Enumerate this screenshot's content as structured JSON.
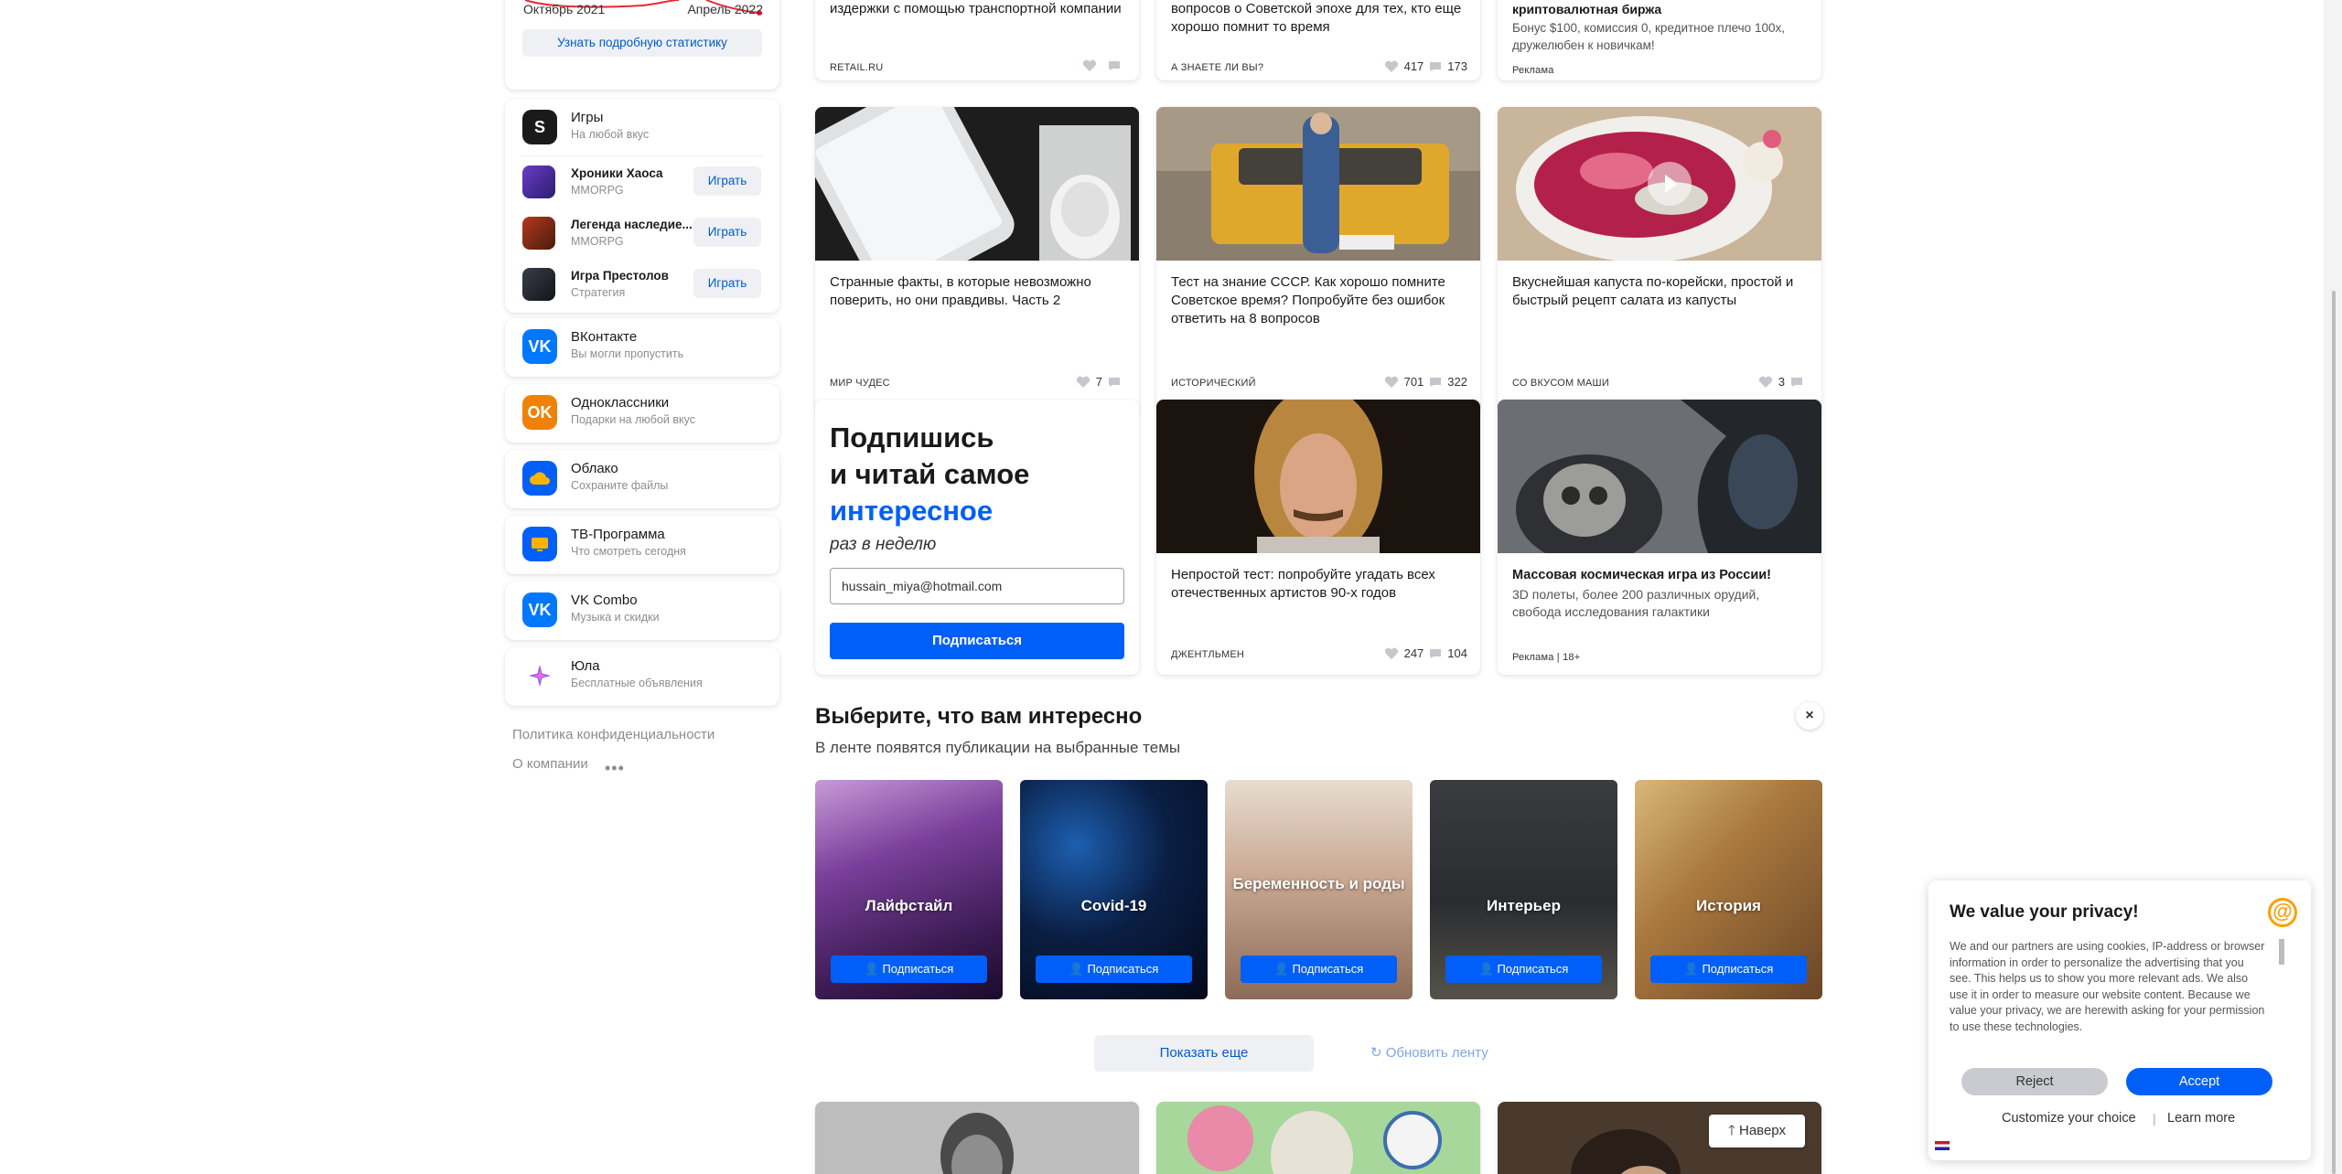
{
  "sidebar": {
    "stats": {
      "label_left": "Октябрь 2021",
      "label_right": "Апрель 2022",
      "button": "Узнать подробную статистику",
      "line_color": "#e52a3a"
    },
    "games": {
      "title": "Игры",
      "subtitle": "На любой вкус",
      "items": [
        {
          "title": "Хроники Хаоса",
          "genre": "MMORPG",
          "button": "Играть"
        },
        {
          "title": "Легенда наследие...",
          "genre": "MMORPG",
          "button": "Играть"
        },
        {
          "title": "Игра Престолов",
          "genre": "Стратегия",
          "button": "Играть"
        }
      ]
    },
    "services": [
      {
        "title": "ВКонтакте",
        "subtitle": "Вы могли пропустить",
        "icon": "vk-icon",
        "color": "#0077ff"
      },
      {
        "title": "Одноклассники",
        "subtitle": "Подарки на любой вкус",
        "icon": "ok-icon",
        "color": "#ee8208"
      },
      {
        "title": "Облако",
        "subtitle": "Сохраните файлы",
        "icon": "cloud-icon",
        "color": "#005ff9"
      },
      {
        "title": "ТВ-Программа",
        "subtitle": "Что смотреть сегодня",
        "icon": "tv-icon",
        "color": "#005ff9"
      },
      {
        "title": "VK Combo",
        "subtitle": "Музыка и скидки",
        "icon": "vk-icon",
        "color": "#0077ff"
      },
      {
        "title": "Юла",
        "subtitle": "Бесплатные объявления",
        "icon": "sparkle-icon",
        "color": "#ffffff"
      }
    ],
    "footer": {
      "privacy": "Политика конфиденциальности",
      "about": "О компании",
      "more": "•••"
    }
  },
  "feed": {
    "top_row": [
      {
        "title_tail": "издержки с помощью транспортной компании",
        "source": "RETAIL.RU",
        "likes": "",
        "comments": ""
      },
      {
        "title_tail": "вопросов о Советской эпохе для тех, кто еще хорошо помнит то время",
        "source": "А ЗНАЕТЕ ЛИ ВЫ?",
        "likes": "417",
        "comments": "173"
      },
      {
        "title_tail": "криптовалютная биржа",
        "desc": "Бонус $100, комиссия 0, кредитное плечо 100x, дружелюбен к новичкам!",
        "source": "Реклама"
      }
    ],
    "row2": [
      {
        "title": "Странные факты, в которые невозможно поверить, но они правдивы. Часть 2",
        "source": "МИР ЧУДЕС",
        "likes": "7",
        "comments": ""
      },
      {
        "title": "Тест на знание СССР. Как хорошо помните Советское время? Попробуйте без ошибок ответить на 8 вопросов",
        "source": "ИСТОРИЧЕСКИЙ",
        "likes": "701",
        "comments": "322"
      },
      {
        "title": "Вкуснейшая капуста по-корейски, простой и быстрый рецепт салата из капусты",
        "source": "СО ВКУСОМ МАШИ",
        "likes": "3",
        "comments": ""
      }
    ],
    "subscribe": {
      "line1": "Подпишись",
      "line2": "и читай самое",
      "line3": "интересное",
      "italic": "раз в неделю",
      "email": "hussain_miya@hotmail.com",
      "button": "Подписаться"
    },
    "row3": [
      {
        "title": "Непростой тест: попробуйте угадать всех отечественных артистов 90-х годов",
        "source": "ДЖЕНТЛЬМЕН",
        "likes": "247",
        "comments": "104"
      },
      {
        "title": "Массовая космическая игра из России!",
        "desc": "3D полеты, более 200 различных орудий, свобода исследования галактики",
        "source": "Реклама | 18+"
      }
    ],
    "topics": {
      "title": "Выберите, что вам интересно",
      "subtitle": "В ленте появятся публикации на выбранные темы",
      "close": "×",
      "items": [
        {
          "label": "Лайфстайл",
          "button": "Подписаться"
        },
        {
          "label": "Covid-19",
          "button": "Подписаться"
        },
        {
          "label": "Беременность и роды",
          "button": "Подписаться"
        },
        {
          "label": "Интерьер",
          "button": "Подписаться"
        },
        {
          "label": "История",
          "button": "Подписаться"
        }
      ]
    },
    "show_more": "Показать еще",
    "refresh": "Обновить ленту",
    "to_top": "Наверх"
  },
  "privacy": {
    "title": "We value your privacy!",
    "text": "We and our partners are using cookies, IP-address or browser information in order to personalize the advertising that you see. This helps us to show you more relevant ads. We also use it in order to measure our website content. Because we value your privacy, we are herewith asking for your permission to use these technologies.",
    "reject": "Reject",
    "accept": "Accept",
    "customize": "Customize your choice",
    "learn_more": "Learn more",
    "separator": "|"
  }
}
